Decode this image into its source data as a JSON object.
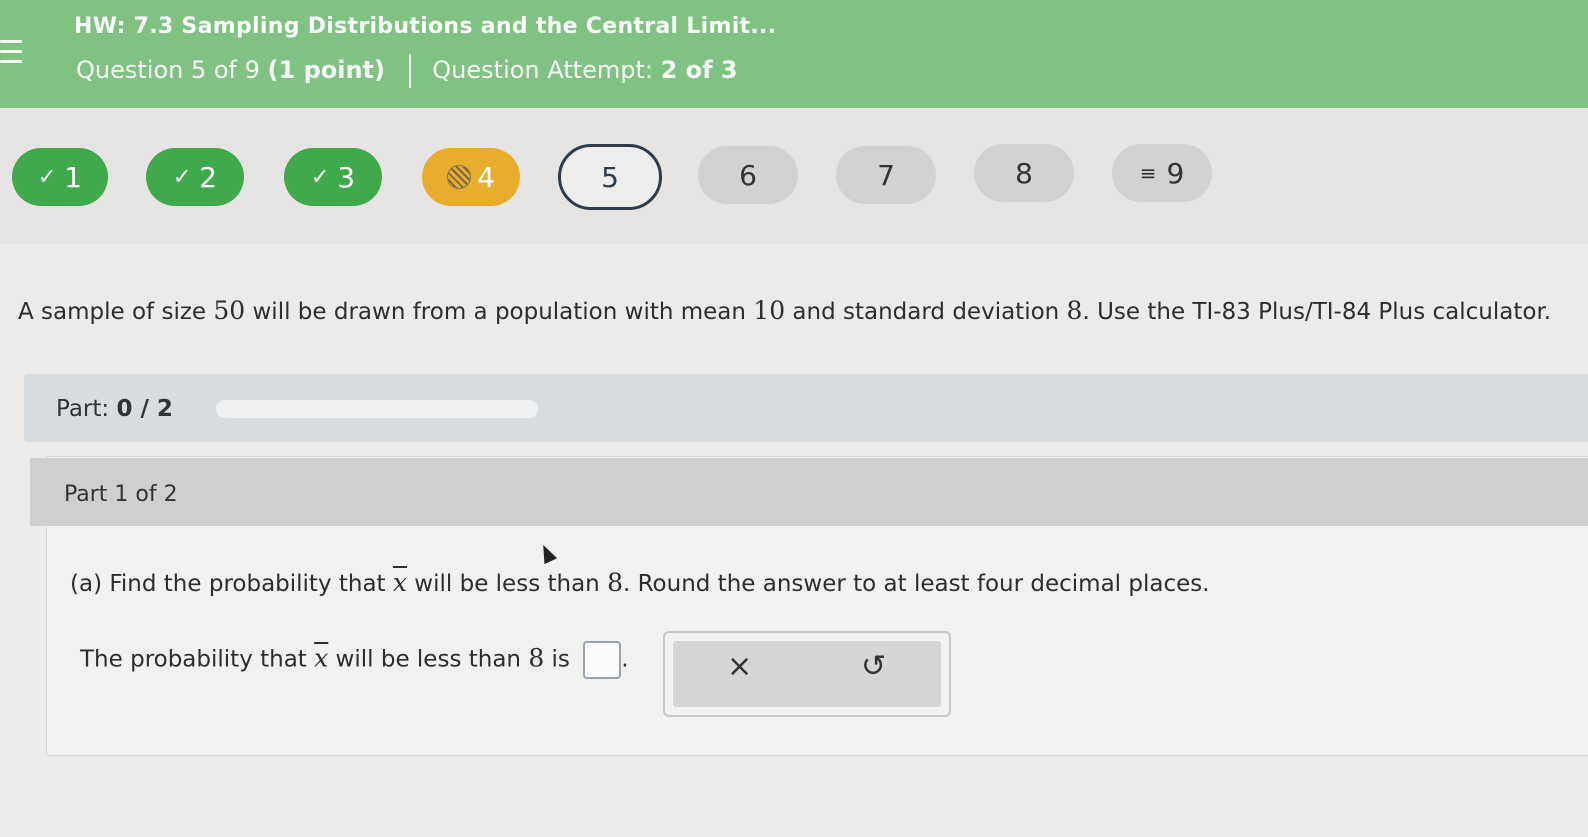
{
  "header": {
    "title": "HW: 7.3 Sampling Distributions and the Central Limit...",
    "question_info": "Question 5 of 9",
    "points": "(1 point)",
    "attempt_label": "Question Attempt:",
    "attempt_value": "2 of 3"
  },
  "questions": [
    {
      "label": "1",
      "status": "correct"
    },
    {
      "label": "2",
      "status": "correct"
    },
    {
      "label": "3",
      "status": "correct"
    },
    {
      "label": "4",
      "status": "partial"
    },
    {
      "label": "5",
      "status": "current"
    },
    {
      "label": "6",
      "status": "unanswered"
    },
    {
      "label": "7",
      "status": "unanswered"
    },
    {
      "label": "8",
      "status": "unanswered"
    },
    {
      "label": "9",
      "status": "unanswered"
    }
  ],
  "problem": {
    "t1": "A sample of size ",
    "n": "50",
    "t2": " will be drawn from a population with mean ",
    "mean": "10",
    "t3": " and standard deviation ",
    "sd": "8",
    "t4": ". Use the TI-83 Plus/TI-84 Plus calculator."
  },
  "progress": {
    "label": "Part:",
    "value": "0 / 2",
    "fraction": 0
  },
  "part": {
    "heading": "Part 1 of 2",
    "q_a1": "(a) Find the probability that ",
    "var": "x",
    "q_a2": " will be less than ",
    "q_a_num": "8",
    "q_a3": ". Round the answer to at least four decimal places.",
    "ans1": "The probability that ",
    "ans2": " will be less than ",
    "ans_num": "8",
    "ans3": " is ",
    "ans_end": "."
  },
  "tools": {
    "clear": "×",
    "undo": "↺"
  },
  "colors": {
    "header": "#7fc282",
    "correct": "#3fa94c",
    "partial": "#e9ad2e",
    "current_border": "#2e3b4b"
  }
}
